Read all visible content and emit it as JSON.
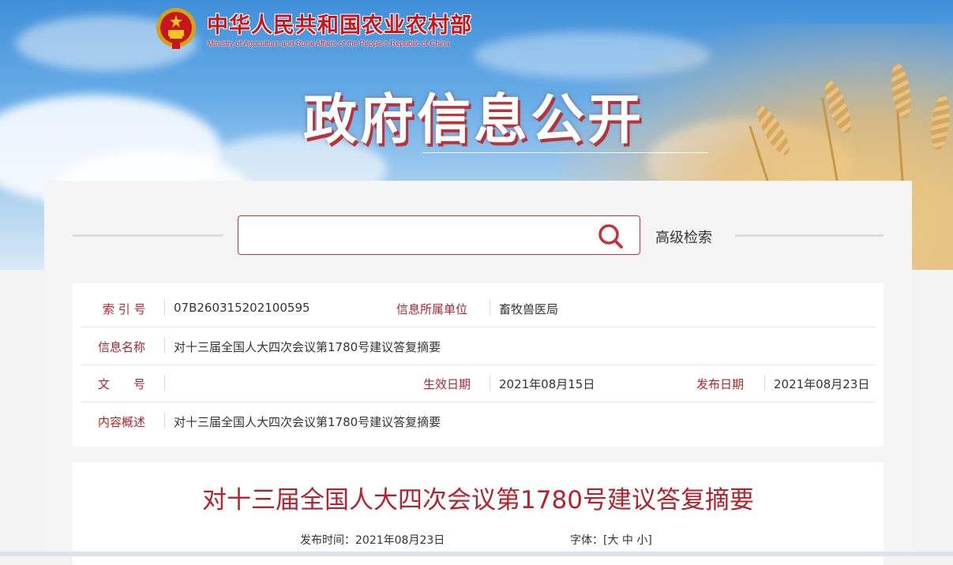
{
  "header": {
    "ministry_cn": "中华人民共和国农业农村部",
    "ministry_en": "Ministry of Agriculture and Rural Affairs of the People's Republic of China",
    "section_title": "政府信息公开",
    "emblem_icon": "national-emblem-icon"
  },
  "search": {
    "value": "",
    "placeholder": "",
    "icon": "search-icon",
    "advanced_label": "高级检索"
  },
  "info": {
    "index_label": "索 引 号",
    "index_value": "07B260315202100595",
    "unit_label": "信息所属单位",
    "unit_value": "畜牧兽医局",
    "name_label": "信息名称",
    "name_value": "对十三届全国人大四次会议第1780号建议答复摘要",
    "doc_label": "文　　号",
    "doc_value": "",
    "effective_label": "生效日期",
    "effective_value": "2021年08月15日",
    "publish_label": "发布日期",
    "publish_value": "2021年08月23日",
    "summary_label": "内容概述",
    "summary_value": "对十三届全国人大四次会议第1780号建议答复摘要"
  },
  "article": {
    "title": "对十三届全国人大四次会议第1780号建议答复摘要",
    "publish_time": "发布时间：2021年08月23日",
    "font_label": "字体：[",
    "font_large": "大",
    "font_medium": "中",
    "font_small": "小",
    "font_close": "]"
  },
  "colors": {
    "accent_red": "#b3232c",
    "brand_red": "#c8161d"
  }
}
